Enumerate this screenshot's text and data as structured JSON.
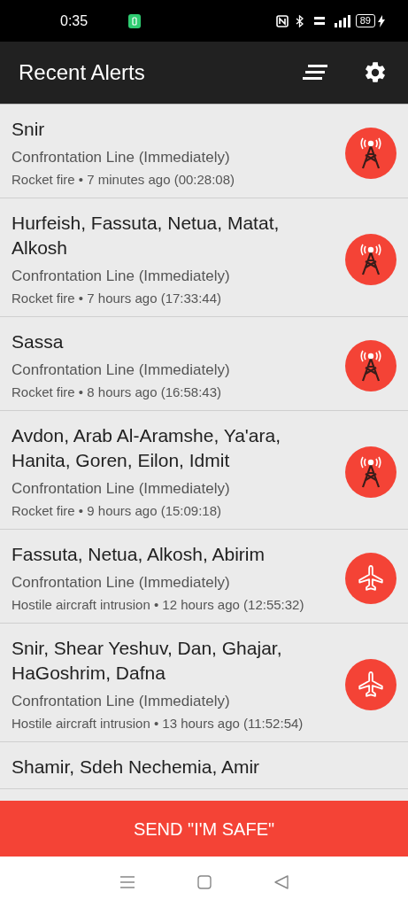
{
  "status_bar": {
    "time": "0:35",
    "battery": "89"
  },
  "app_bar": {
    "title": "Recent Alerts"
  },
  "alerts": [
    {
      "kind": "rocket",
      "locations": "Snir",
      "zone": "Confrontation Line (Immediately)",
      "detail": "Rocket fire • 7 minutes ago (00:28:08)"
    },
    {
      "kind": "rocket",
      "locations": "Hurfeish, Fassuta, Netua, Matat, Alkosh",
      "zone": "Confrontation Line (Immediately)",
      "detail": "Rocket fire • 7 hours ago (17:33:44)"
    },
    {
      "kind": "rocket",
      "locations": "Sassa",
      "zone": "Confrontation Line (Immediately)",
      "detail": "Rocket fire • 8 hours ago (16:58:43)"
    },
    {
      "kind": "rocket",
      "locations": "Avdon, Arab Al-Aramshe, Ya'ara, Hanita, Goren, Eilon, Idmit",
      "zone": "Confrontation Line (Immediately)",
      "detail": "Rocket fire • 9 hours ago (15:09:18)"
    },
    {
      "kind": "aircraft",
      "locations": "Fassuta, Netua, Alkosh, Abirim",
      "zone": "Confrontation Line (Immediately)",
      "detail": "Hostile aircraft intrusion • 12 hours ago (12:55:32)"
    },
    {
      "kind": "aircraft",
      "locations": "Snir, Shear Yeshuv, Dan, Ghajar, HaGoshrim, Dafna",
      "zone": "Confrontation Line (Immediately)",
      "detail": "Hostile aircraft intrusion • 13 hours ago (11:52:54)"
    },
    {
      "kind": "partial",
      "locations": "Shamir, Sdeh Nechemia, Amir"
    }
  ],
  "safe_button": {
    "label": "SEND \"I'M SAFE\""
  }
}
